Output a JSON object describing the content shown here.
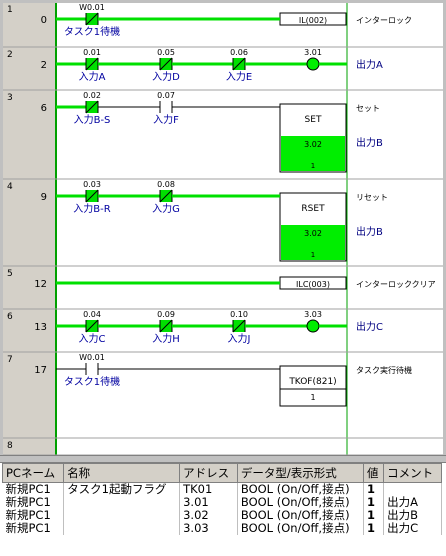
{
  "rungs": [
    {
      "num": "1",
      "step": "0",
      "contacts": [
        {
          "addr": "W0.01",
          "label": "タスク1待機"
        }
      ],
      "box": {
        "text": "IL(002)"
      },
      "comment": "インターロック"
    },
    {
      "num": "2",
      "step": "2",
      "contacts": [
        {
          "addr": "0.01",
          "label": "入力A"
        },
        {
          "addr": "0.05",
          "label": "入力D"
        },
        {
          "addr": "0.06",
          "label": "入力E"
        }
      ],
      "coil": {
        "addr": "3.01"
      },
      "comment": "出力A"
    },
    {
      "num": "3",
      "step": "6",
      "contacts": [
        {
          "addr": "0.02",
          "label": "入力B-S"
        },
        {
          "addr": "0.07",
          "label": "入力F"
        }
      ],
      "box": {
        "text": "SET",
        "addr": "3.02",
        "value": "1"
      },
      "comment": "セット",
      "comment2": "出力B"
    },
    {
      "num": "4",
      "step": "9",
      "contacts": [
        {
          "addr": "0.03",
          "label": "入力B-R"
        },
        {
          "addr": "0.08",
          "label": "入力G"
        }
      ],
      "box": {
        "text": "RSET",
        "addr": "3.02",
        "value": "1"
      },
      "comment": "リセット",
      "comment2": "出力B"
    },
    {
      "num": "5",
      "step": "12",
      "box": {
        "text": "ILC(003)"
      },
      "comment": "インターロッククリア"
    },
    {
      "num": "6",
      "step": "13",
      "contacts": [
        {
          "addr": "0.04",
          "label": "入力C"
        },
        {
          "addr": "0.09",
          "label": "入力H"
        },
        {
          "addr": "0.10",
          "label": "入力J"
        }
      ],
      "coil": {
        "addr": "3.03"
      },
      "comment": "出力C"
    },
    {
      "num": "7",
      "step": "17",
      "contacts": [
        {
          "addr": "W0.01",
          "label": "タスク1待機"
        }
      ],
      "box": {
        "text": "TKOF(821)",
        "value": "1"
      },
      "comment": "タスク実行待機"
    },
    {
      "num": "8"
    }
  ],
  "table": {
    "headers": [
      "PCネーム",
      "名称",
      "アドレス",
      "データ型/表示形式",
      "値",
      "コメント"
    ],
    "rows": [
      [
        "新規PC1",
        "タスク1起動フラグ",
        "TK01",
        "BOOL (On/Off,接点)",
        "1",
        ""
      ],
      [
        "新規PC1",
        "",
        "3.01",
        "BOOL (On/Off,接点)",
        "1",
        "出力A"
      ],
      [
        "新規PC1",
        "",
        "3.02",
        "BOOL (On/Off,接点)",
        "1",
        "出力B"
      ],
      [
        "新規PC1",
        "",
        "3.03",
        "BOOL (On/Off,接点)",
        "1",
        "出力C"
      ]
    ]
  },
  "colors": {
    "energized": "#00e000",
    "coil_fill": "#00ee00",
    "rail": "#00a000",
    "comment_blue": "#000080",
    "label_blue": "#0000a0"
  }
}
